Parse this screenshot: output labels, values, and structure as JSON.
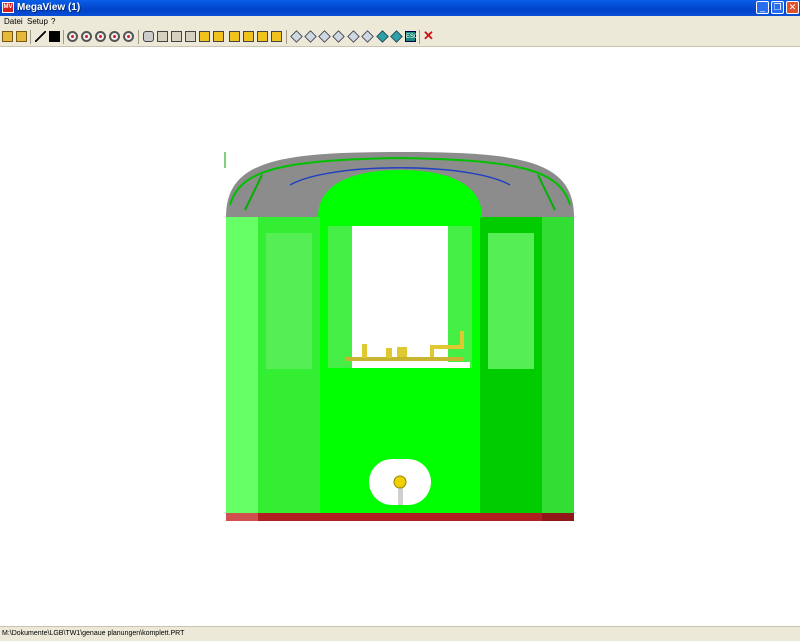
{
  "window": {
    "title": "MegaView (1)",
    "icon": "app-logo-icon",
    "controls": [
      "minimize-icon",
      "maximize-icon",
      "close-icon"
    ]
  },
  "menu": {
    "items": [
      {
        "label": "Datei"
      },
      {
        "label": "Setup"
      },
      {
        "label": "?"
      }
    ]
  },
  "toolbar": {
    "tools": [
      {
        "icon": "open-folder-icon"
      },
      {
        "icon": "save-icon"
      },
      {
        "icon": "wireframe-icon"
      },
      {
        "icon": "invert-icon"
      },
      {
        "icon": "zoom-in-icon"
      },
      {
        "icon": "zoom-out-icon"
      },
      {
        "icon": "zoom-window-icon"
      },
      {
        "icon": "zoom-previous-icon"
      },
      {
        "icon": "zoom-all-icon"
      },
      {
        "icon": "cylinder-icon"
      },
      {
        "icon": "view-front-icon"
      },
      {
        "icon": "view-back-icon"
      },
      {
        "icon": "view-left-icon"
      },
      {
        "icon": "view-right-icon"
      },
      {
        "icon": "view-top-icon"
      },
      {
        "icon": "view-bottom-icon"
      },
      {
        "icon": "iso-1-icon"
      },
      {
        "icon": "iso-2-icon"
      },
      {
        "icon": "iso-3-icon"
      },
      {
        "icon": "iso-4-icon"
      },
      {
        "icon": "cube-1-icon"
      },
      {
        "icon": "cube-2-icon"
      },
      {
        "icon": "cube-3-icon"
      },
      {
        "icon": "cube-4-icon"
      },
      {
        "icon": "cube-5-icon"
      },
      {
        "icon": "cube-6-icon"
      },
      {
        "icon": "cube-7-icon"
      },
      {
        "icon": "cube-8-icon"
      },
      {
        "icon": "escape-icon",
        "label": "ESC"
      },
      {
        "icon": "cancel-icon"
      }
    ]
  },
  "status": {
    "path": "M:\\Dokumente\\LGB\\TW1\\genaue planungen\\komplett.PRT"
  },
  "colors": {
    "titlebar": "#0a5ee8",
    "chrome": "#ece9d8",
    "body_green": "#00ff00",
    "body_light_green": "#66ff66",
    "roof_gray": "#8c8c8c",
    "skirt_red": "#b02020",
    "window_white": "#ffffff"
  }
}
